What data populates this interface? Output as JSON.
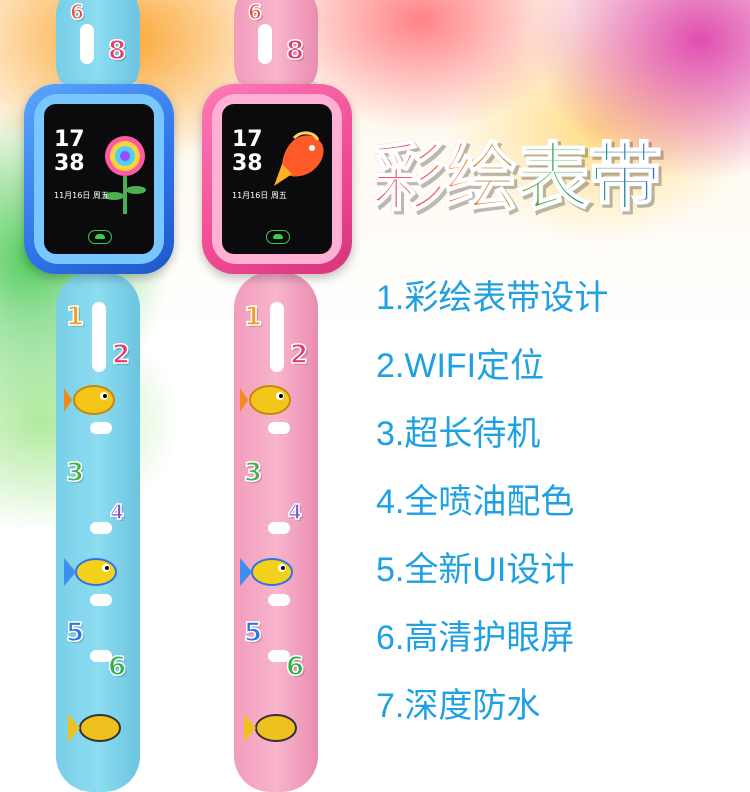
{
  "headline": "彩绘表带",
  "features": [
    "1.彩绘表带设计",
    "2.WIFI定位",
    "3.超长待机",
    "4.全喷油配色",
    "5.全新UI设计",
    "6.高清护眼屏",
    "7.深度防水"
  ],
  "watches": [
    {
      "variant": "blue",
      "time_hour": "17",
      "time_min": "38",
      "date": "11月16日 周五",
      "screen_graphic": "flower-icon"
    },
    {
      "variant": "pink",
      "time_hour": "17",
      "time_min": "38",
      "date": "11月16日 周五",
      "screen_graphic": "fish-icon"
    }
  ],
  "strap_numbers": [
    "6",
    "8",
    "1",
    "2",
    "3",
    "4",
    "5",
    "6"
  ],
  "colors": {
    "feature_text": "#1fa0e3",
    "blue_strap": "#7fd3ec",
    "pink_strap": "#f4a8c6",
    "blue_case": "#2f73e8",
    "pink_case": "#f04a92"
  }
}
